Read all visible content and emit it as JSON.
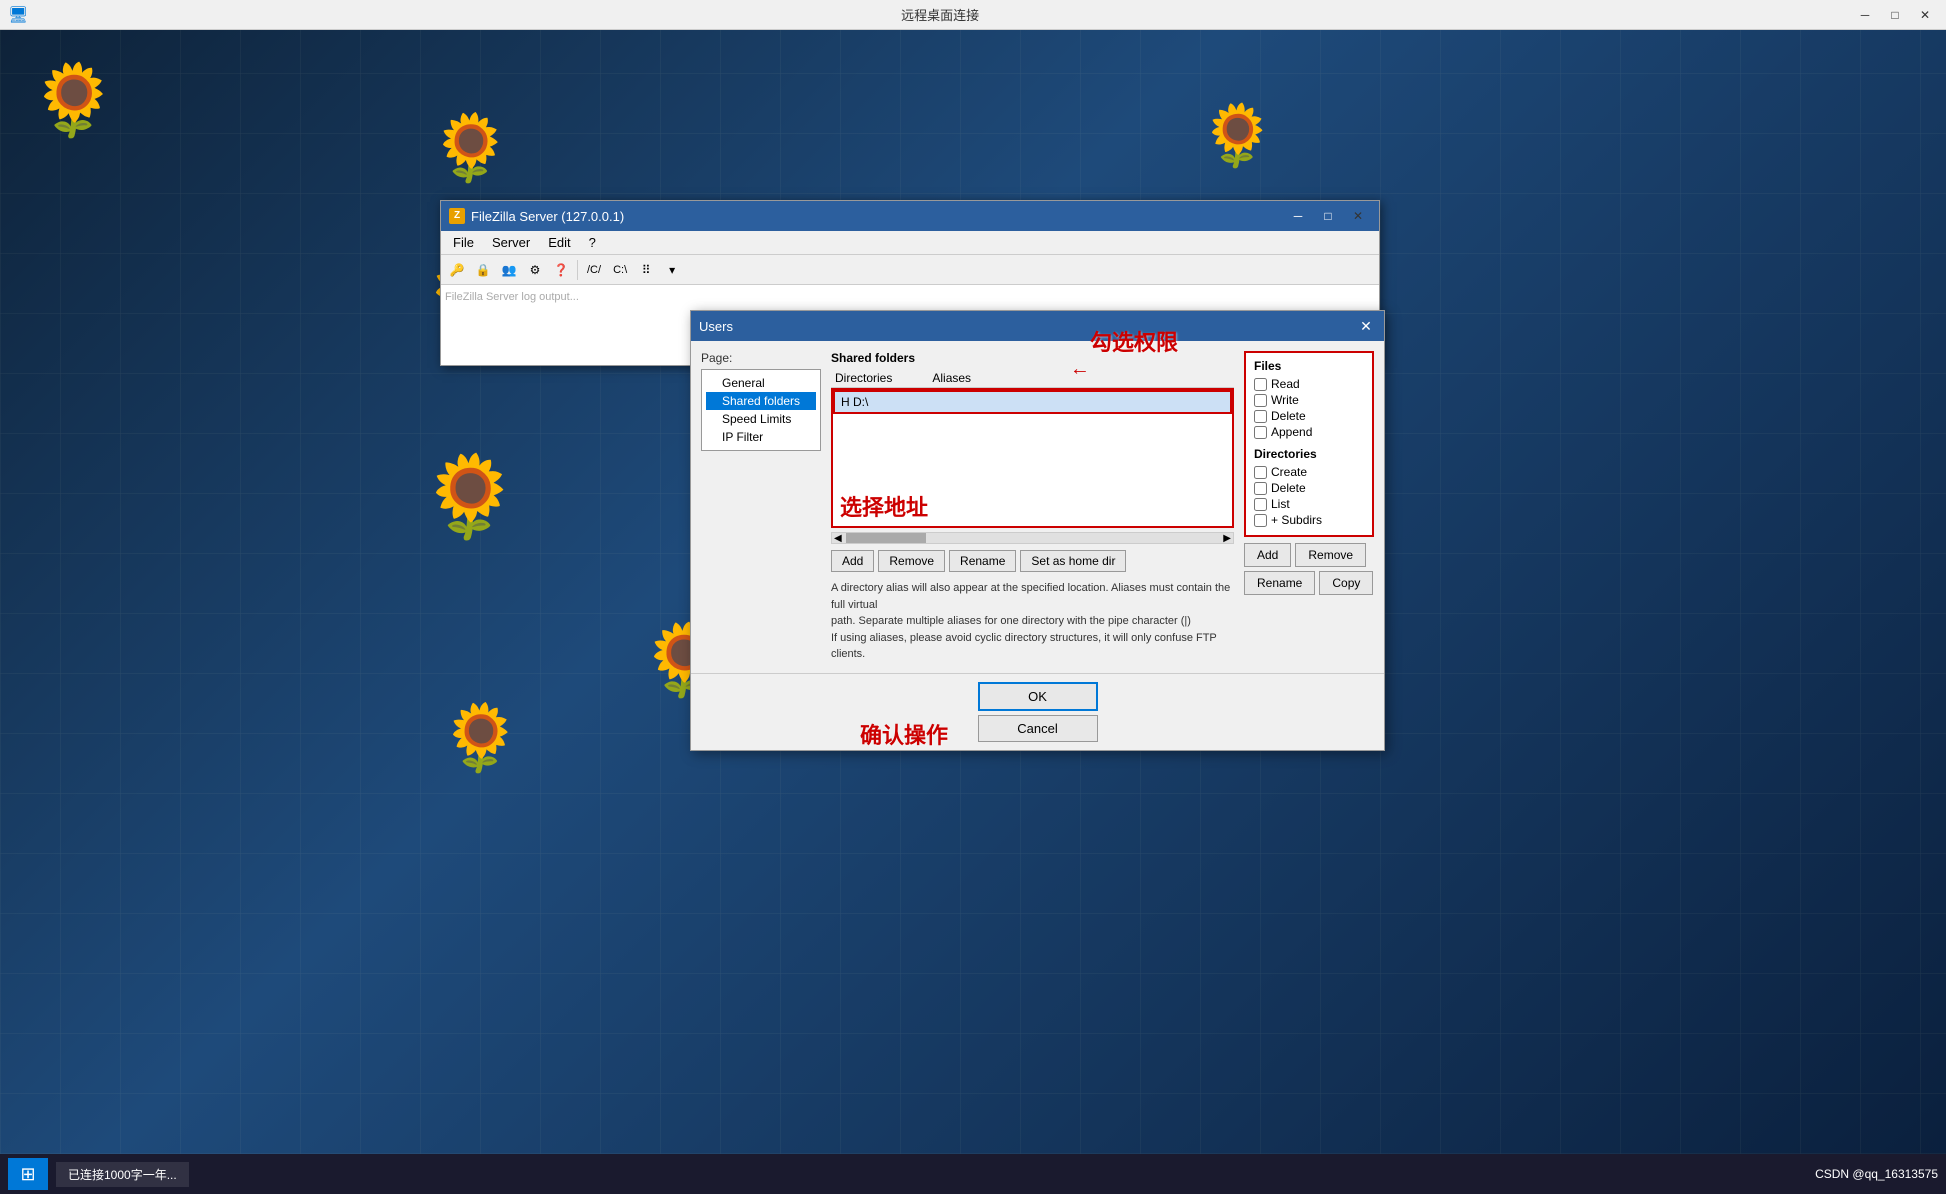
{
  "outerWindow": {
    "title": "远程桌面连接",
    "minBtn": "─",
    "maxBtn": "□",
    "closeBtn": "✕"
  },
  "filezilla": {
    "title": "FileZilla Server (127.0.0.1)",
    "icon": "Z",
    "menu": [
      "File",
      "Server",
      "Edit",
      "?"
    ],
    "toolbar": [
      "🔑",
      "🔒",
      "📋",
      "📋",
      "❓",
      "/C/",
      "C:\\",
      "⠿",
      "▾"
    ]
  },
  "usersDialog": {
    "title": "Users",
    "pageLabel": "Page:",
    "navItems": [
      {
        "label": "General",
        "level": "child",
        "selected": false
      },
      {
        "label": "Shared folders",
        "level": "child",
        "selected": true
      },
      {
        "label": "Speed Limits",
        "level": "child",
        "selected": false
      },
      {
        "label": "IP Filter",
        "level": "child",
        "selected": false
      }
    ],
    "sharedFoldersLabel": "Shared folders",
    "tableHeaders": [
      "Directories",
      "Aliases"
    ],
    "directoryItem": "H  D:\\",
    "dirButtons": [
      "Add",
      "Remove",
      "Rename",
      "Set as home dir"
    ],
    "infoText1": "A directory alias will also appear at the specified location. Aliases must contain the full virtual",
    "infoText2": "path. Separate multiple aliases for one directory with the pipe character (|)",
    "infoText3": "If using aliases, please avoid cyclic directory structures, it will only confuse FTP clients.",
    "filesSection": {
      "title": "Files",
      "checkboxes": [
        {
          "label": "Read",
          "checked": false
        },
        {
          "label": "Write",
          "checked": false
        },
        {
          "label": "Delete",
          "checked": false
        },
        {
          "label": "Append",
          "checked": false
        }
      ]
    },
    "directoriesSection": {
      "title": "Directories",
      "checkboxes": [
        {
          "label": "Create",
          "checked": false
        },
        {
          "label": "Delete",
          "checked": false
        },
        {
          "label": "List",
          "checked": false
        },
        {
          "label": "+ Subdirs",
          "checked": false
        }
      ]
    },
    "rightButtons": [
      "Add",
      "Remove",
      "Rename",
      "Copy"
    ],
    "okBtn": "OK",
    "cancelBtn": "Cancel"
  },
  "annotations": {
    "selectAddress": "选择地址",
    "checkPermissions": "勾选权限",
    "confirmOperation": "确认操作"
  },
  "taskbar": {
    "startIcon": "⊞",
    "items": [
      "已连接1000字一年..."
    ],
    "rightText": "CSDN @qq_16313575"
  }
}
